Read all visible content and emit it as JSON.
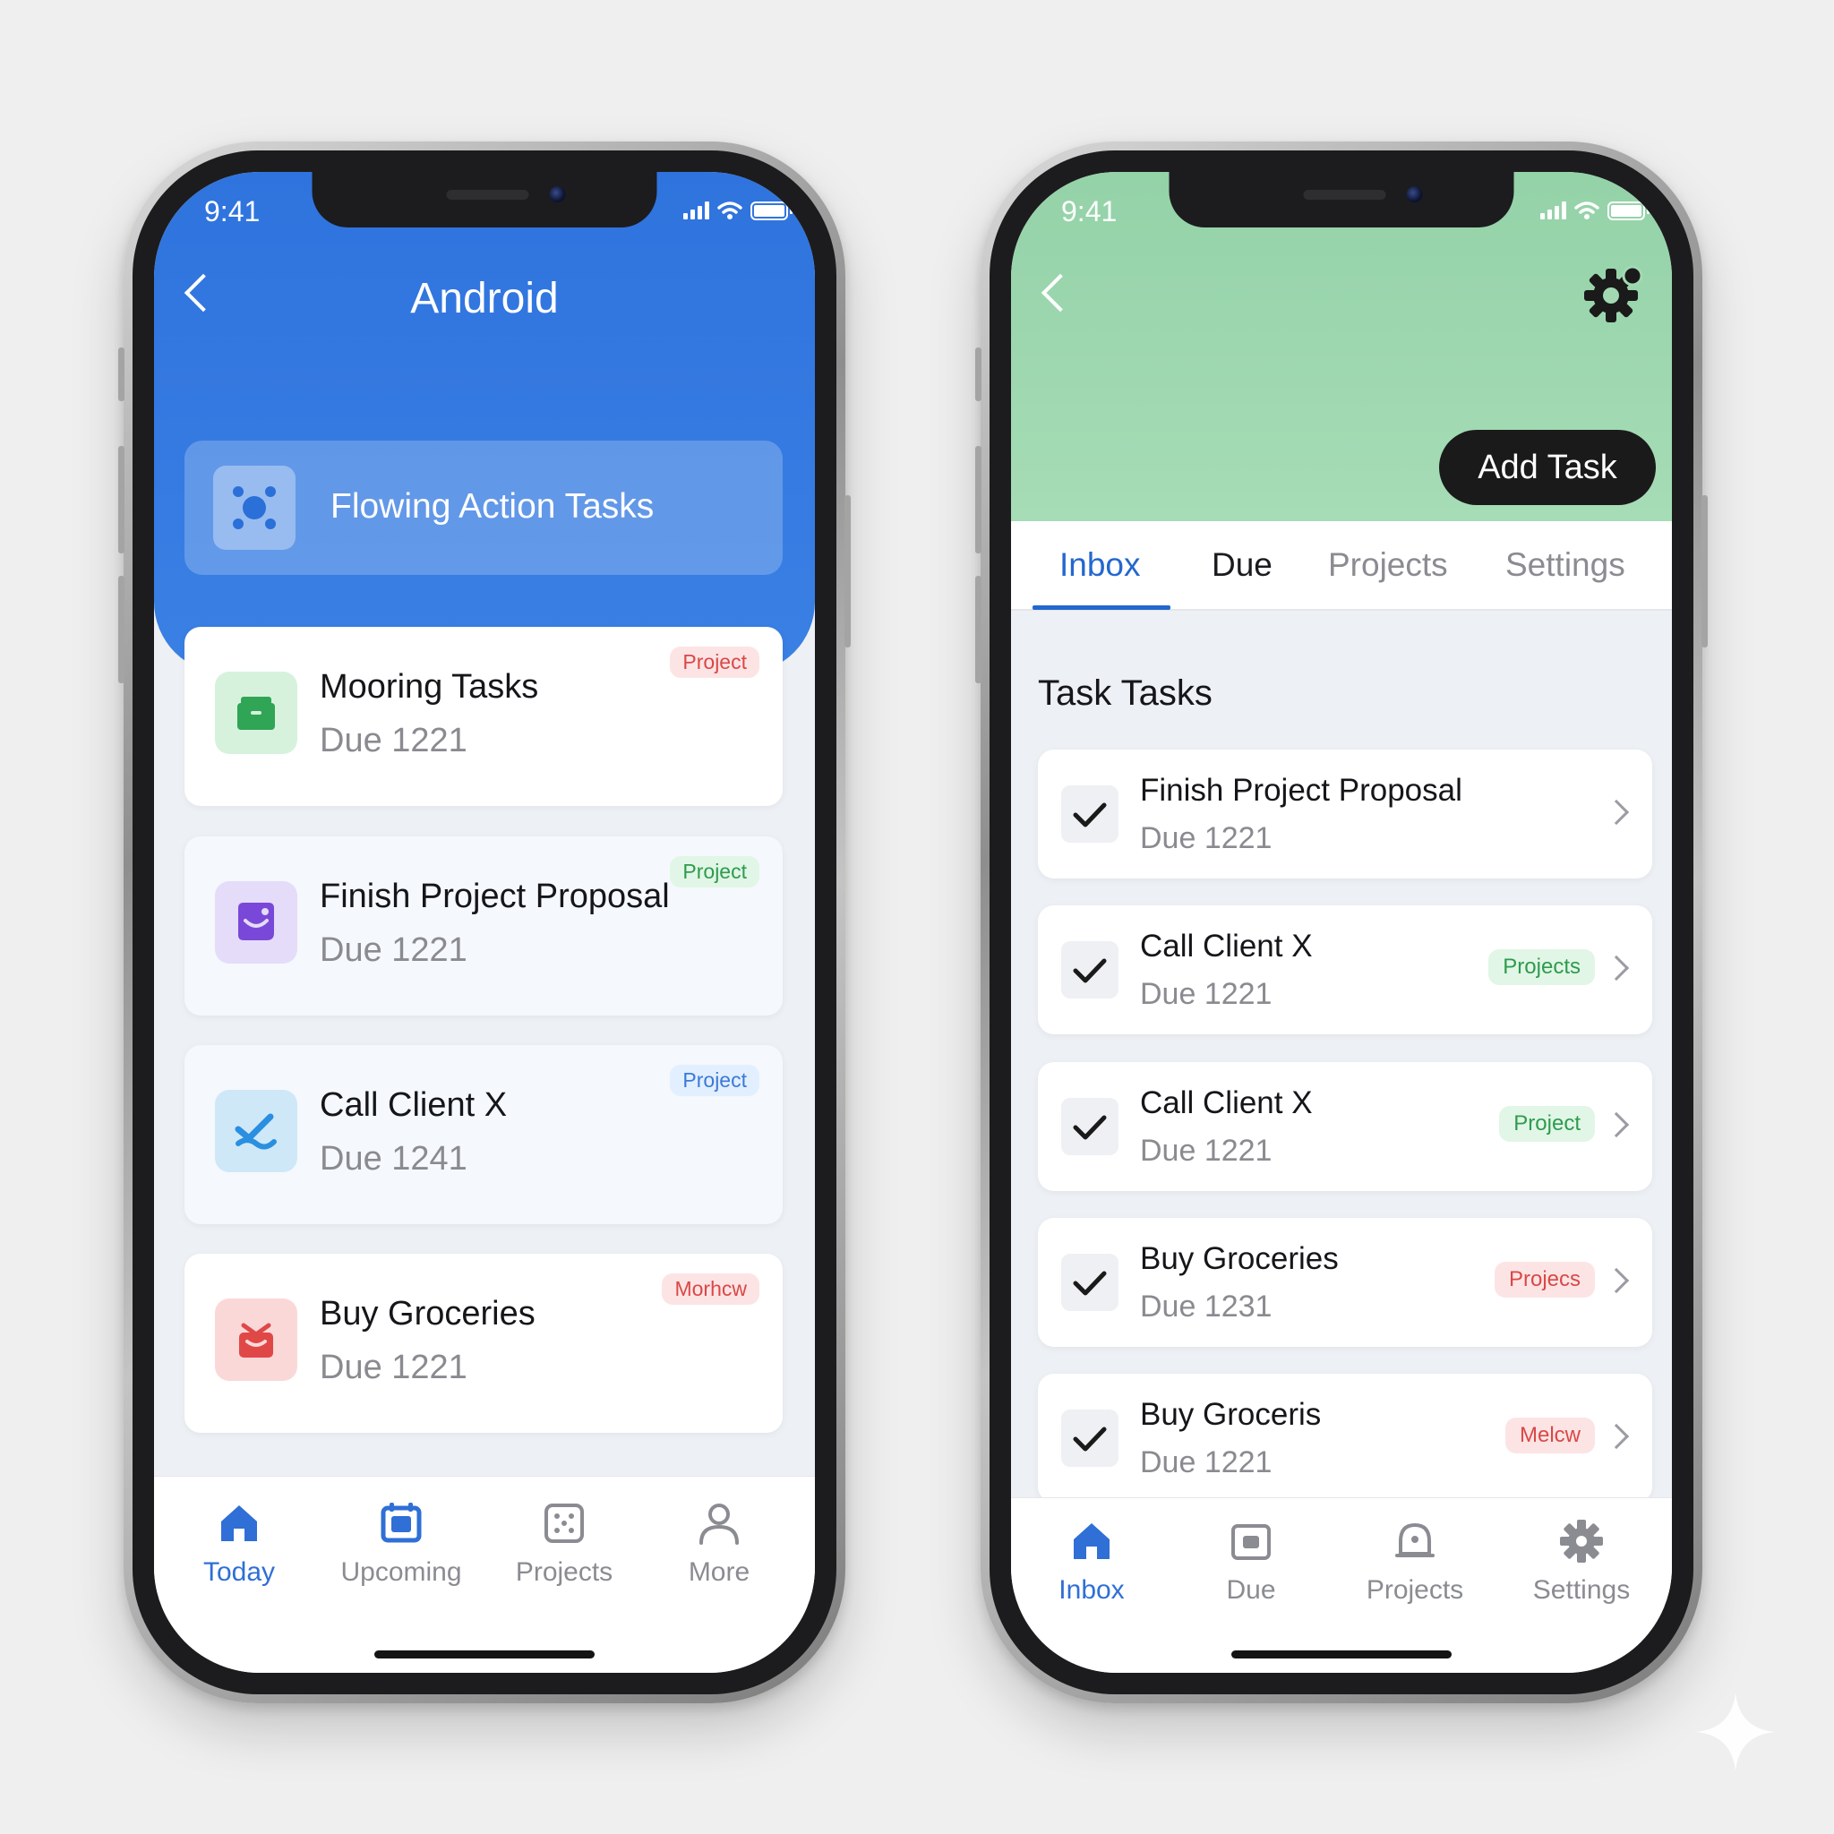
{
  "left_phone": {
    "status_time": "9:41",
    "header_title": "Android",
    "banner": {
      "label": "Flowing Action Tasks",
      "icon": "expand-icon"
    },
    "tasks": [
      {
        "title": "Mooring Tasks",
        "due": "Due 1221",
        "badge": "Project",
        "badge_color": "#d94848",
        "icon": "folder-icon",
        "icon_color": "#2fa555"
      },
      {
        "title": "Finish Project Proposal",
        "due": "Due 1221",
        "badge": "Project",
        "badge_color": "#2e9b4d",
        "icon": "chat-icon",
        "icon_color": "#7a48d8"
      },
      {
        "title": "Call Client X",
        "due": "Due 1241",
        "badge": "Project",
        "badge_color": "#3c79d8",
        "icon": "check-wave-icon",
        "icon_color": "#2a8fe0"
      },
      {
        "title": "Buy Groceries",
        "due": "Due 1221",
        "badge": "Morhcw",
        "badge_color": "#d94848",
        "icon": "bag-icon",
        "icon_color": "#e04848"
      }
    ],
    "nav": [
      {
        "label": "Today",
        "icon": "home-icon",
        "active": true
      },
      {
        "label": "Upcoming",
        "icon": "calendar-icon",
        "active": false
      },
      {
        "label": "Projects",
        "icon": "dice-icon",
        "active": false
      },
      {
        "label": "More",
        "icon": "person-icon",
        "active": false
      }
    ]
  },
  "right_phone": {
    "status_time": "9:41",
    "add_task_label": "Add Task",
    "tabs": [
      {
        "label": "Inbox",
        "active": true
      },
      {
        "label": "Due",
        "active": false
      },
      {
        "label": "Projects",
        "active": false
      },
      {
        "label": "Settings",
        "active": false
      }
    ],
    "section_title": "Task Tasks",
    "tasks": [
      {
        "title": "Finish Project Proposal",
        "due": "Due 1221",
        "badge": ""
      },
      {
        "title": "Call Client X",
        "due": "Due 1221",
        "badge": "Projects",
        "badge_color": "#2e9b4d"
      },
      {
        "title": "Call Client X",
        "due": "Due 1221",
        "badge": "Project",
        "badge_color": "#2e9b4d"
      },
      {
        "title": "Buy Groceries",
        "due": "Due 1231",
        "badge": "Projecs",
        "badge_color": "#d94848"
      },
      {
        "title": "Buy Groceris",
        "due": "Due 1221",
        "badge": "Melcw",
        "badge_color": "#d94848"
      }
    ],
    "nav": [
      {
        "label": "Inbox",
        "icon": "home-icon",
        "active": true
      },
      {
        "label": "Due",
        "icon": "calendar-icon",
        "active": false
      },
      {
        "label": "Projects",
        "icon": "bell-icon",
        "active": false
      },
      {
        "label": "Settings",
        "icon": "gear-icon",
        "active": false
      }
    ]
  },
  "colors": {
    "left_header": "#2f73de",
    "right_header": "#94d2a8",
    "accent_blue": "#2467cf"
  }
}
